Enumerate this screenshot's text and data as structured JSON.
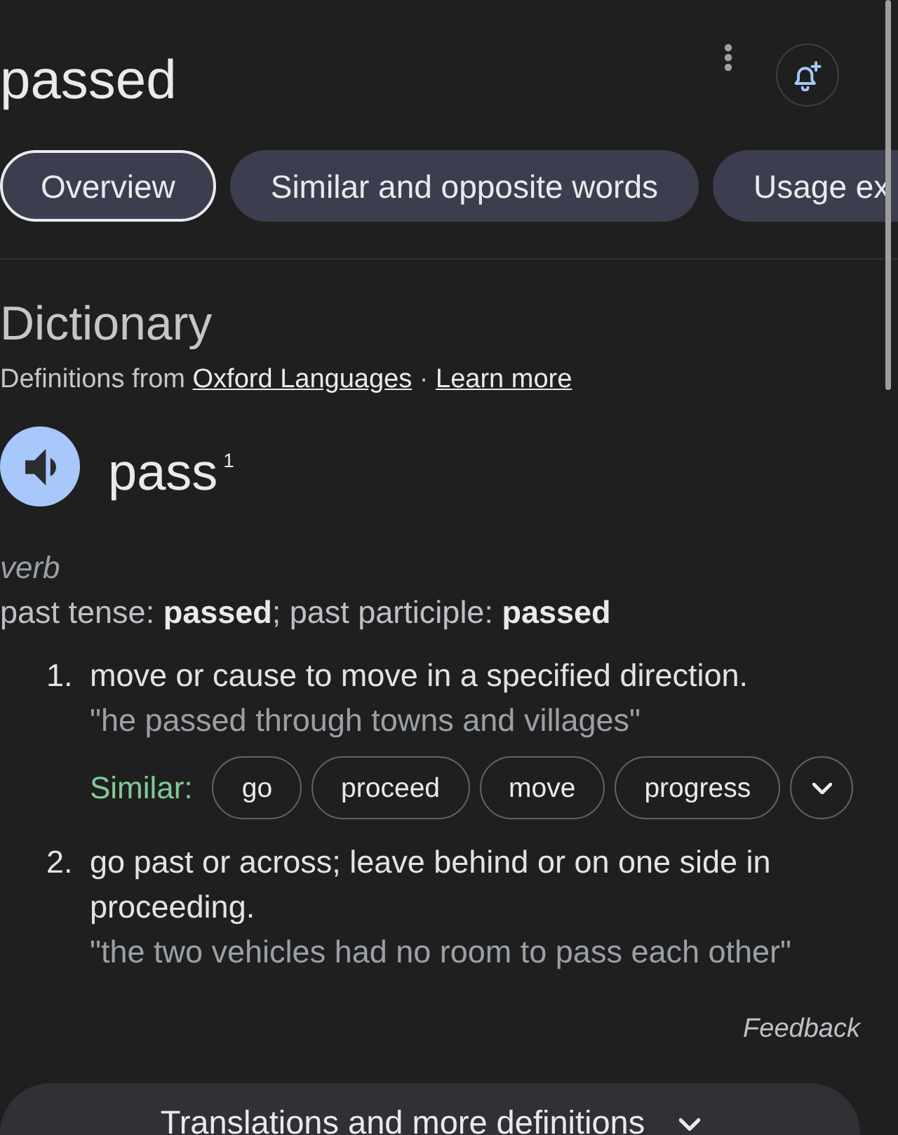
{
  "header": {
    "title": "passed"
  },
  "tabs": [
    {
      "label": "Overview",
      "selected": true
    },
    {
      "label": "Similar and opposite words",
      "selected": false
    },
    {
      "label": "Usage ex",
      "selected": false
    }
  ],
  "dictionary": {
    "heading": "Dictionary",
    "source_text": "Definitions from",
    "source_link": "Oxford Languages",
    "separator": "·",
    "learn_more_link": "Learn more"
  },
  "entry": {
    "headword": "pass$^{1}$",
    "part_of_speech": "verb",
    "inflections": "past tense: **passed**; past participle: **passed**",
    "senses": [
      {
        "number": "1.",
        "definition": "move or cause to move in a specified direction.",
        "example": "\"he passed through towns and villages\"",
        "similar_label": "Similar:",
        "similar_words": [
          "go",
          "proceed",
          "move",
          "progress"
        ]
      },
      {
        "number": "2.",
        "definition": "go past or across; leave behind or on one side in proceeding.",
        "example": "\"the two vehicles had no room to pass each other\""
      }
    ]
  },
  "feedback": "Feedback",
  "more_button": {
    "label": "Translations and more definitions"
  }
}
